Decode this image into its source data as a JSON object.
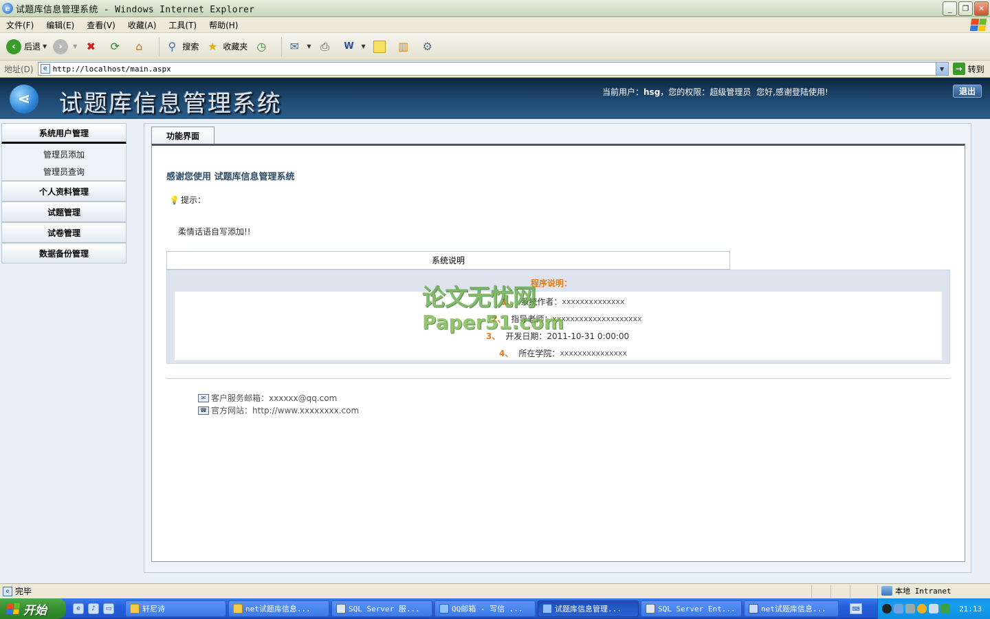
{
  "window": {
    "title": "试题库信息管理系统 - Windows Internet Explorer",
    "buttons": [
      "_",
      "❐",
      "✕"
    ]
  },
  "menu": [
    "文件(F)",
    "编辑(E)",
    "查看(V)",
    "收藏(A)",
    "工具(T)",
    "帮助(H)"
  ],
  "toolbar": {
    "back": "后退",
    "search": "搜索",
    "favorites": "收藏夹"
  },
  "address": {
    "label": "地址(D)",
    "url": "http://localhost/main.aspx",
    "go": "转到"
  },
  "banner": {
    "title": "试题库信息管理系统",
    "user_prefix": "当前用户：",
    "user": "hsg",
    "role_prefix": "，您的权限：",
    "role": "超级管理员",
    "greeting": "您好,感谢登陆使用!",
    "logout": "退出"
  },
  "sidebar": {
    "groups": [
      {
        "label": "系统用户管理",
        "items": [
          "管理员添加",
          "管理员查询"
        ]
      },
      {
        "label": "个人资料管理"
      },
      {
        "label": "试题管理"
      },
      {
        "label": "试卷管理"
      },
      {
        "label": "数据备份管理"
      }
    ]
  },
  "main": {
    "tab": "功能界面",
    "welcome": "感谢您使用 试题库信息管理系统",
    "hint_label": "提示：",
    "sweet_text": "柔情话语自写添加!!",
    "sysnote_header": "系统说明",
    "program_title": "程序说明：",
    "items": [
      {
        "num": "1、",
        "label": "系统作者：",
        "value": "xxxxxxxxxxxxxx"
      },
      {
        "num": "2、",
        "label": "指导老师：",
        "value": "xxxxxxxxxxxxxxxxxxxx"
      },
      {
        "num": "3、",
        "label": "开发日期：",
        "value": "2011-10-31 0:00:00"
      },
      {
        "num": "4、",
        "label": "所在学院：",
        "value": "xxxxxxxxxxxxxxx"
      }
    ],
    "email_label": "客户服务邮箱：",
    "email": "xxxxxx@qq.com",
    "site_label": "官方网站：",
    "site": "http://www.xxxxxxxx.com"
  },
  "watermark": {
    "line1": "论文无忧网",
    "line2": "Paper51.com"
  },
  "statusbar": {
    "status": "完毕",
    "zone": "本地 Intranet"
  },
  "taskbar": {
    "start": "开始",
    "tasks": [
      {
        "label": "轩尼诗",
        "active": false
      },
      {
        "label": "net试题库信息...",
        "active": false
      },
      {
        "label": "SQL Server 服...",
        "active": false
      },
      {
        "label": "QQ邮箱 - 写信 ...",
        "active": false
      },
      {
        "label": "试题库信息管理...",
        "active": true
      },
      {
        "label": "SQL Server Ent...",
        "active": false
      },
      {
        "label": "net试题库信息...",
        "active": false
      }
    ],
    "clock": "21:13"
  },
  "colors": {
    "banner_dark": "#0d2742",
    "accent_orange": "#e87a1a",
    "welcome_text": "#2e4b66",
    "taskbar_blue": "#245edb"
  }
}
